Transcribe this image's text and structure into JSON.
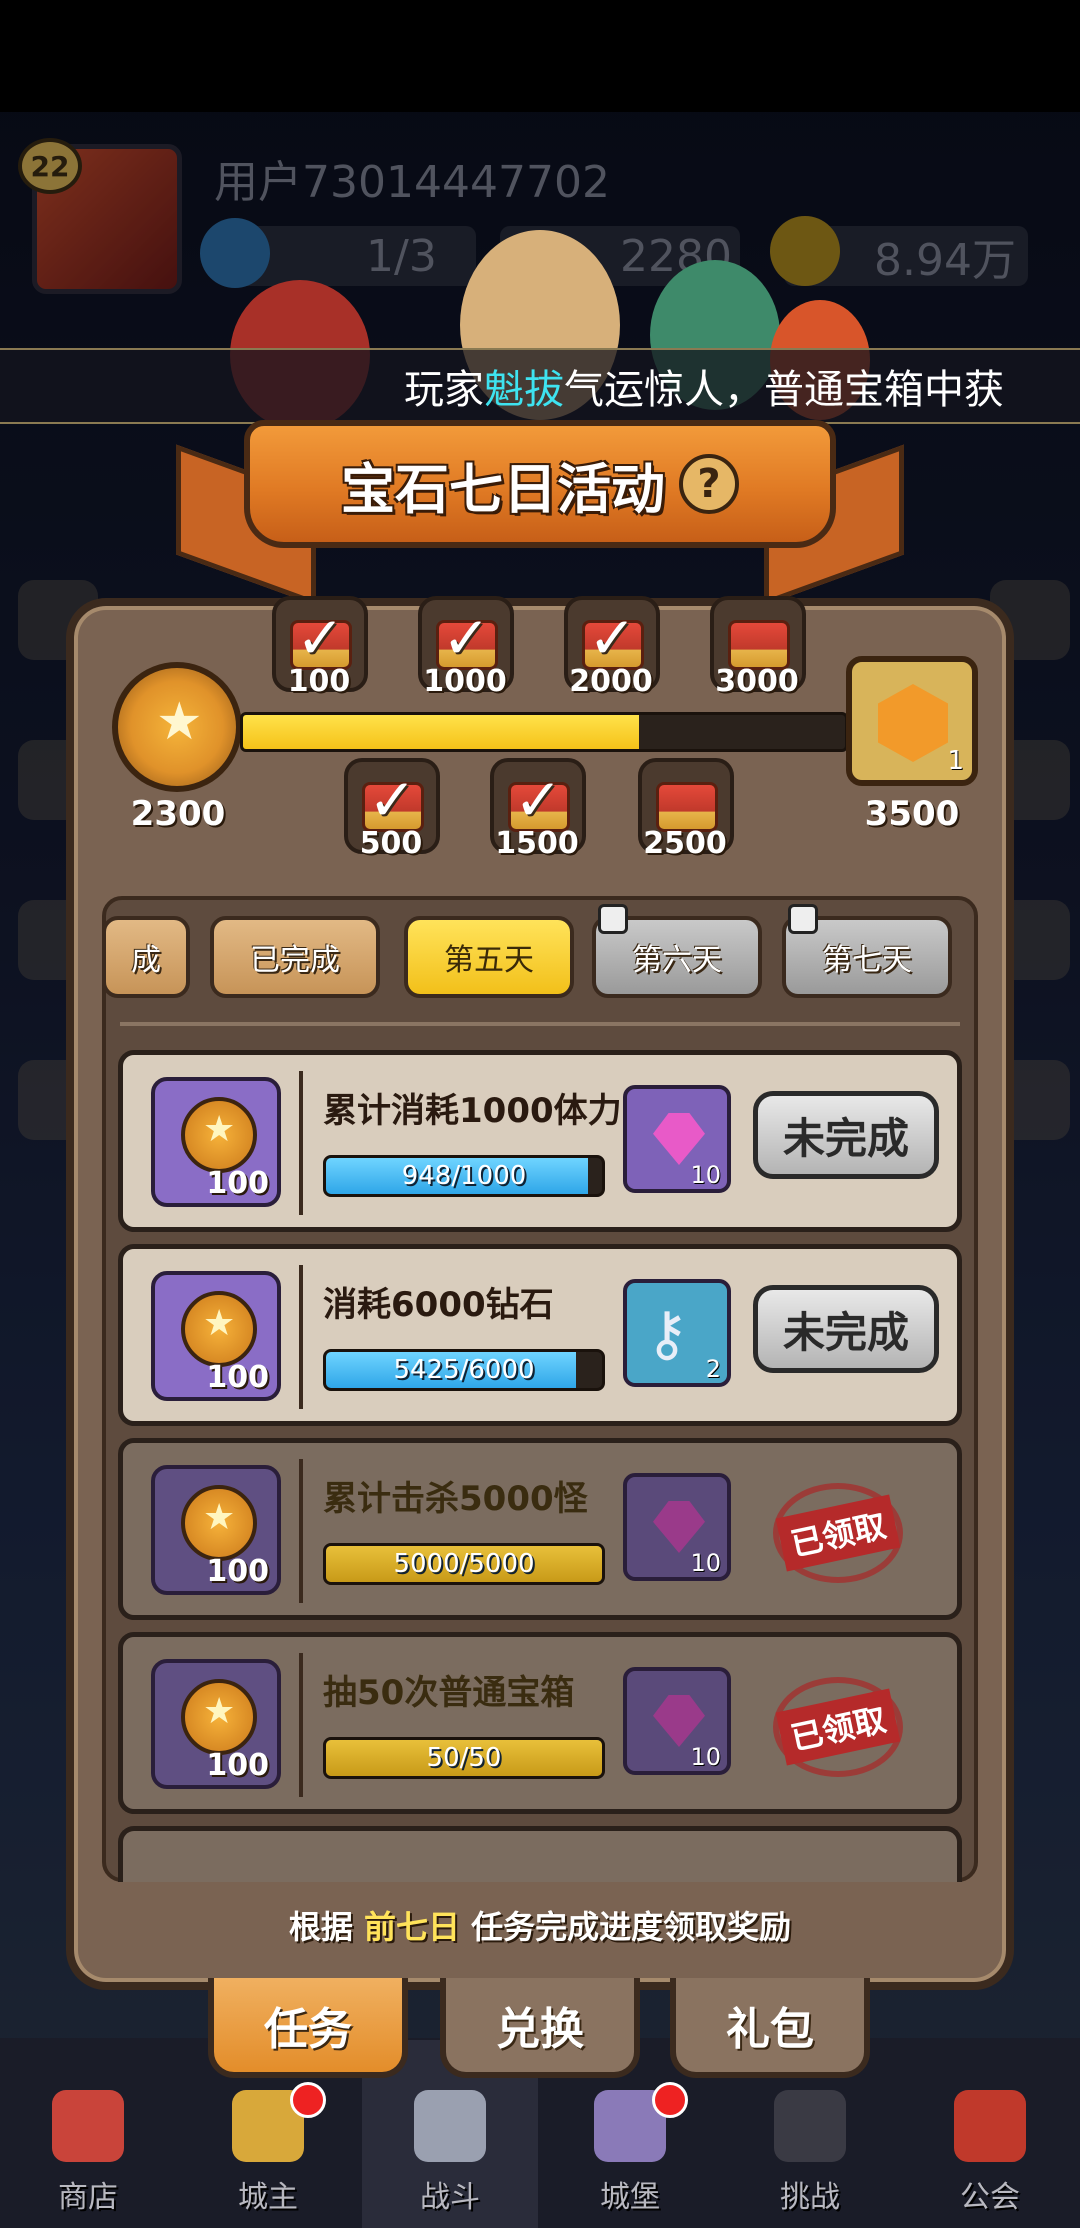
{
  "header": {
    "level": "22",
    "username": "用户73014447702",
    "stamina": "1/3",
    "diamonds": "2280",
    "gold": "8.94万"
  },
  "marquee": {
    "prefix": "玩家",
    "player": "魁拔",
    "suffix": "气运惊人，普通宝箱中获"
  },
  "event": {
    "title": "宝石七日活动",
    "help": "?"
  },
  "progress": {
    "current": "2300",
    "max": "3500",
    "fraction": 0.657,
    "final_reward_count": "1",
    "milestones_top": [
      "100",
      "1000",
      "2000",
      "3000"
    ],
    "milestones_bottom": [
      "500",
      "1500",
      "2500"
    ]
  },
  "days": {
    "tabs": [
      "成",
      "已完成",
      "第五天",
      "第六天",
      "第七天"
    ],
    "active": "第五天"
  },
  "tasks": [
    {
      "title": "累计消耗1000体力",
      "points": "100",
      "progress": "948/1000",
      "fraction": 0.948,
      "reward_count": "10",
      "reward": "gem-icon",
      "status": "未完成"
    },
    {
      "title": "消耗6000钻石",
      "points": "100",
      "progress": "5425/6000",
      "fraction": 0.904,
      "reward_count": "2",
      "reward": "key-icon",
      "status": "未完成"
    },
    {
      "title": "累计击杀5000怪",
      "points": "100",
      "progress": "5000/5000",
      "fraction": 1.0,
      "reward_count": "10",
      "reward": "gem-icon",
      "status": "已领取"
    },
    {
      "title": "抽50次普通宝箱",
      "points": "100",
      "progress": "50/50",
      "fraction": 1.0,
      "reward_count": "10",
      "reward": "gem-icon",
      "status": "已领取"
    }
  ],
  "footer": {
    "prefix": "根据",
    "highlight": "前七日",
    "suffix": "任务完成进度领取奖励"
  },
  "sub_tabs": [
    "任务",
    "兑换",
    "礼包"
  ],
  "bottom_nav": [
    "商店",
    "城主",
    "战斗",
    "城堡",
    "挑战",
    "公会"
  ],
  "colors": {
    "progress_fill": "#f5c219",
    "task_bar_open": "#2fa6e8",
    "task_bar_done": "#c89a18",
    "highlight": "#3ee3f0"
  }
}
